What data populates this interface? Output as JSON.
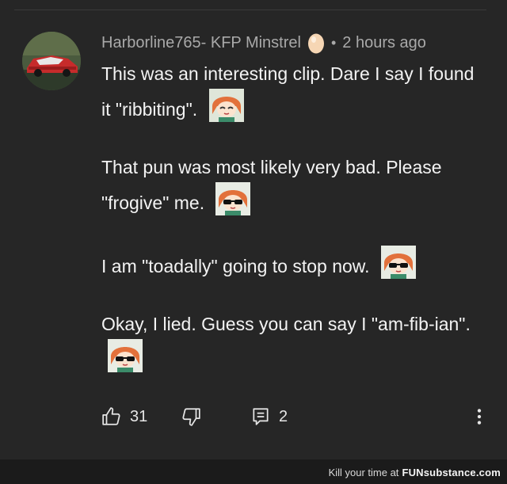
{
  "comment": {
    "author": "Harborline765- KFP Minstrel",
    "badge_icon": "egg-icon",
    "separator": "•",
    "timestamp": "2 hours ago",
    "paragraphs": [
      {
        "text": "This was an interesting clip. Dare I say I found it \"ribbiting\".",
        "emote": "chibi-emote-icon"
      },
      {
        "text": "That pun was most likely very bad. Please \"frogive\" me.",
        "emote": "sunglasses-emote-icon"
      },
      {
        "text": "I am \"toadally\" going to stop now.",
        "emote": "sunglasses-emote-icon"
      },
      {
        "text": "Okay, I lied. Guess you can say I \"am-fib-ian\".",
        "emote": "sunglasses-emote-icon"
      }
    ]
  },
  "actions": {
    "like_count": "31",
    "reply_count": "2",
    "icons": [
      "thumbs-up-icon",
      "thumbs-down-icon",
      "reply-icon",
      "more-vert-icon"
    ]
  },
  "watermark": {
    "prefix": "Kill your time at",
    "brand": "FUNsubstance.com"
  }
}
